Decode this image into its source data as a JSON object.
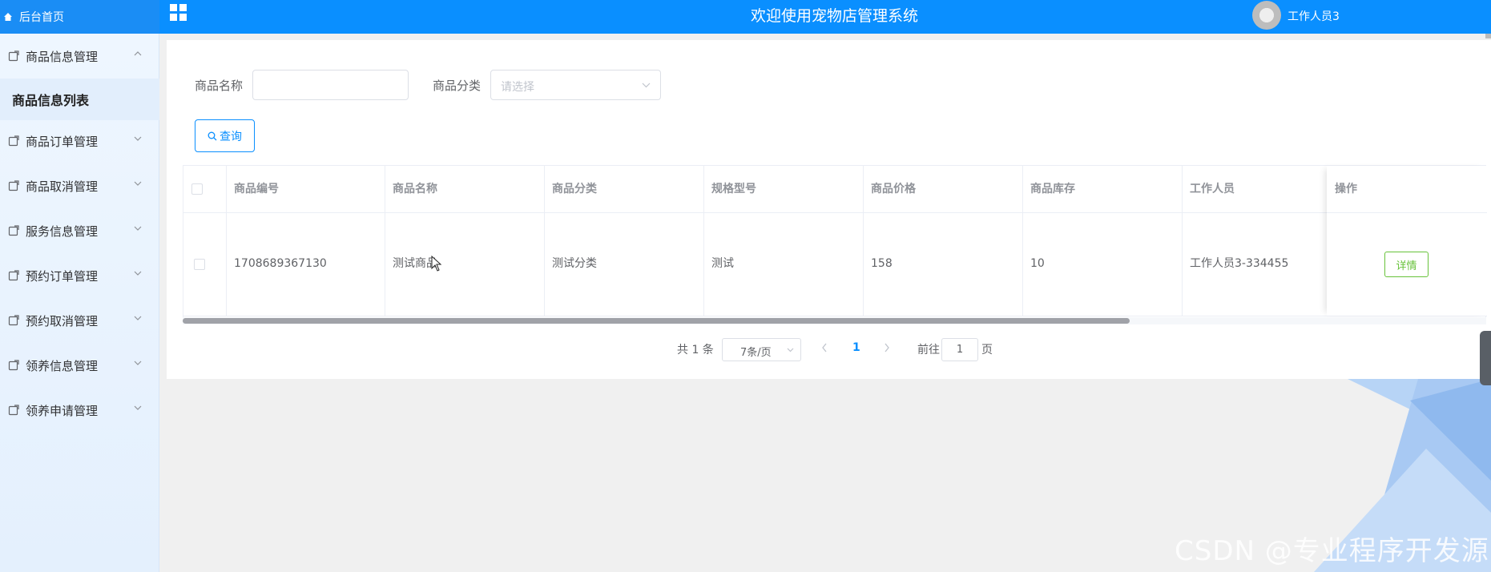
{
  "header": {
    "home_label": "后台首页",
    "title": "欢迎使用宠物店管理系统",
    "user_name": "工作人员3"
  },
  "sidebar": {
    "items": [
      {
        "label": "商品信息管理",
        "expanded": true
      },
      {
        "label": "商品订单管理",
        "expanded": false
      },
      {
        "label": "商品取消管理",
        "expanded": false
      },
      {
        "label": "服务信息管理",
        "expanded": false
      },
      {
        "label": "预约订单管理",
        "expanded": false
      },
      {
        "label": "预约取消管理",
        "expanded": false
      },
      {
        "label": "领养信息管理",
        "expanded": false
      },
      {
        "label": "领养申请管理",
        "expanded": false
      }
    ],
    "active_sub": "商品信息列表"
  },
  "search": {
    "name_label": "商品名称",
    "name_value": "",
    "category_label": "商品分类",
    "category_placeholder": "请选择",
    "query_button": "查询"
  },
  "table": {
    "columns": [
      "商品编号",
      "商品名称",
      "商品分类",
      "规格型号",
      "商品价格",
      "商品库存",
      "工作人员",
      "操作"
    ],
    "rows": [
      {
        "code": "1708689367130",
        "name": "测试商品",
        "category": "测试分类",
        "spec": "测试",
        "price": "158",
        "stock": "10",
        "staff": "工作人员3-334455",
        "action": "详情"
      }
    ]
  },
  "pagination": {
    "total_text": "共 1 条",
    "page_size": "7条/页",
    "current_page": "1",
    "goto_label": "前往",
    "goto_value": "1",
    "page_unit": "页"
  },
  "watermark": "CSDN @专业程序开发源",
  "colors": {
    "primary": "#0a8fff",
    "success": "#67c23a",
    "sidebar_bg": "#eaf4ff"
  }
}
